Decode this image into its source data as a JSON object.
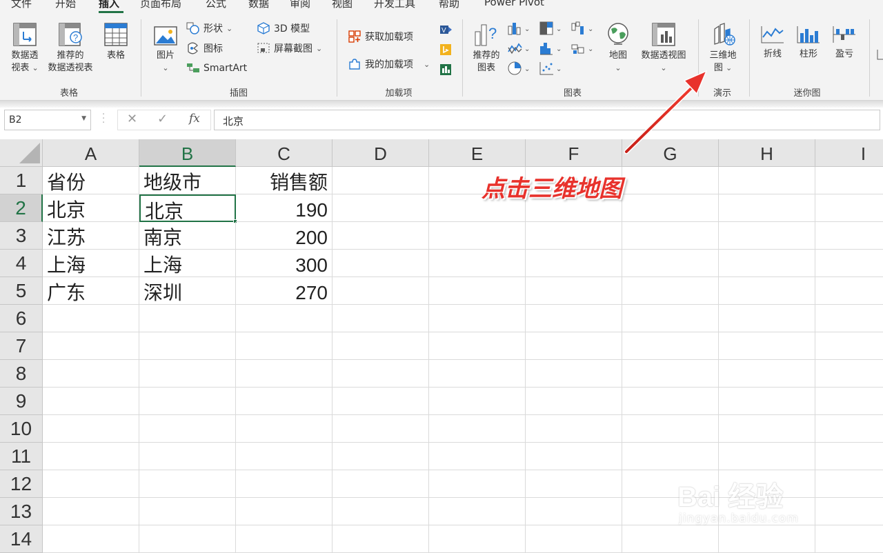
{
  "ribbon_tabs": [
    "文件",
    "开始",
    "插入",
    "页面布局",
    "公式",
    "数据",
    "审阅",
    "视图",
    "开发工具",
    "帮助",
    "Power Pivot"
  ],
  "ribbon": {
    "groups": {
      "tables": "表格",
      "illustrations": "插图",
      "addins": "加载项",
      "charts": "图表",
      "tours": "演示",
      "sparklines": "迷你图"
    },
    "pivot_line1": "数据透",
    "pivot_line2": "视表",
    "recommended_pivot_line1": "推荐的",
    "recommended_pivot_line2": "数据透视表",
    "table": "表格",
    "pictures": "图片",
    "shapes": "形状",
    "icons": "图标",
    "smartart": "SmartArt",
    "model3d": "3D 模型",
    "screenshot": "屏幕截图",
    "get_addins": "获取加载项",
    "my_addins": "我的加载项",
    "recommended_charts_line1": "推荐的",
    "recommended_charts_line2": "图表",
    "maps": "地图",
    "pivot_chart": "数据透视图",
    "map3d_line1": "三维地",
    "map3d_line2": "图",
    "spark_line": "折线",
    "spark_column": "柱形",
    "spark_winloss": "盈亏"
  },
  "formula_bar": {
    "name_box": "B2",
    "value": "北京"
  },
  "sheet": {
    "columns": [
      "A",
      "B",
      "C",
      "D",
      "E",
      "F",
      "G",
      "H",
      "I"
    ],
    "rows": [
      "1",
      "2",
      "3",
      "4",
      "5",
      "6",
      "7",
      "8",
      "9",
      "10",
      "11",
      "12",
      "13",
      "14"
    ],
    "cells": {
      "A1": "省份",
      "B1": "地级市",
      "C1": "销售额",
      "A2": "北京",
      "B2": "北京",
      "C2": "190",
      "A3": "江苏",
      "B3": "南京",
      "C3": "200",
      "A4": "上海",
      "B4": "上海",
      "C4": "300",
      "A5": "广东",
      "B5": "深圳",
      "C5": "270"
    },
    "active_cell": "B2"
  },
  "annotation": "点击三维地图",
  "watermark": {
    "brand": "Bai 经验",
    "url": "jingyan.baidu.com"
  },
  "colors": {
    "excel_green": "#217346",
    "annotation_red": "#e8322c"
  }
}
